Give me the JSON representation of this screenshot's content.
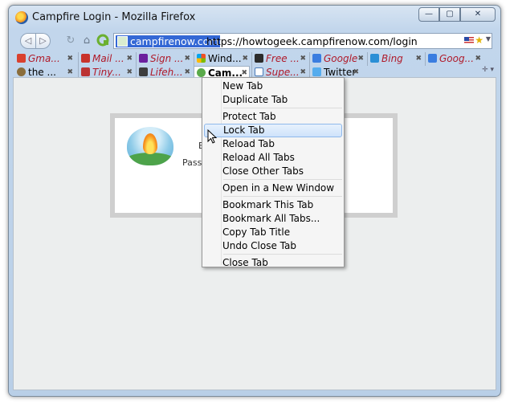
{
  "window": {
    "title": "Campfire Login - Mozilla Firefox",
    "controls": [
      "—",
      "▢",
      "✕"
    ]
  },
  "navbar": {
    "back_icon": "◁",
    "forward_icon": "▷",
    "reload_icon": "↻",
    "home_icon": "⌂",
    "site_identity": "campfirenow.com",
    "url": "https://howtogeek.campfirenow.com/login"
  },
  "tabs_row1": [
    {
      "label": "Gma...",
      "color": "#d9412f",
      "italic": true
    },
    {
      "label": "Mail ...",
      "color": "#c8322b",
      "italic": true
    },
    {
      "label": "Sign ...",
      "color": "#6b1f9e",
      "italic": true
    },
    {
      "label": "Wind...",
      "color": "#2a74c8",
      "italic": false
    },
    {
      "label": "Free ...",
      "color": "#2b2b2b",
      "italic": true
    },
    {
      "label": "Google",
      "color": "#3a7de0",
      "italic": true
    },
    {
      "label": "Bing",
      "color": "#2a8fd6",
      "italic": true
    },
    {
      "label": "Goog...",
      "color": "#3a7de0",
      "italic": true
    }
  ],
  "tabs_row2": [
    {
      "label": "the ...",
      "color": "#8a6d3b",
      "italic": false
    },
    {
      "label": "Tiny...",
      "color": "#b33",
      "italic": true
    },
    {
      "label": "Lifeh...",
      "color": "#3d3d3d",
      "italic": true
    },
    {
      "label": "Cam...",
      "color": "#5aaa4a",
      "italic": false,
      "active": true
    },
    {
      "label": "Supe...",
      "color": "#4a7ab8",
      "italic": true
    },
    {
      "label": "Twitter",
      "color": "#55acee",
      "italic": false
    }
  ],
  "page": {
    "fragment_email": "E",
    "fragment_password": "Passw"
  },
  "context_menu": {
    "groups": [
      [
        "New Tab",
        "Duplicate Tab"
      ],
      [
        "Protect Tab",
        "Lock Tab",
        "Reload Tab",
        "Reload All Tabs",
        "Close Other Tabs"
      ],
      [
        "Open in a New Window"
      ],
      [
        "Bookmark This Tab",
        "Bookmark All Tabs...",
        "Copy Tab Title",
        "Undo Close Tab"
      ],
      [
        "Close Tab"
      ]
    ],
    "highlighted": "Lock Tab"
  }
}
